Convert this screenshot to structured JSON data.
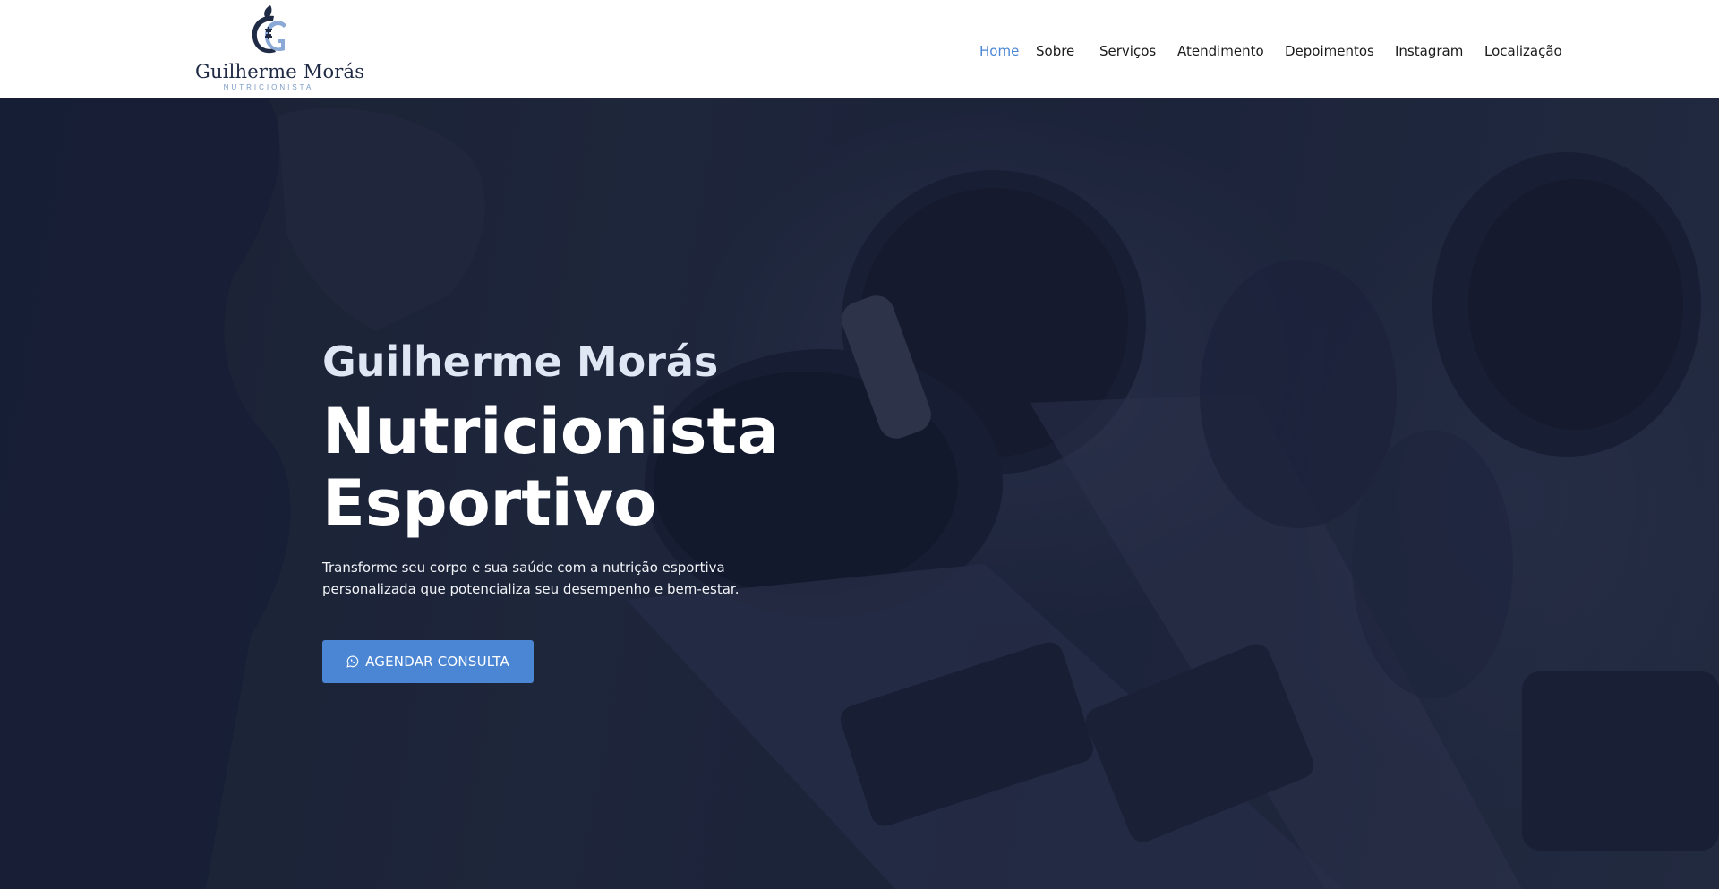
{
  "brand": {
    "name": "Guilherme Morás",
    "subtitle": "NUTRICIONISTA",
    "logo_icon": "apple-dumbbell-monogram-icon"
  },
  "nav": {
    "items": [
      {
        "label": "Home",
        "active": true
      },
      {
        "label": "Sobre"
      },
      {
        "label": "Serviços"
      },
      {
        "label": "Atendimento"
      },
      {
        "label": "Depoimentos"
      },
      {
        "label": "Instagram"
      },
      {
        "label": "Localização"
      }
    ]
  },
  "hero": {
    "name": "Guilherme Morás",
    "title_line1": "Nutricionista",
    "title_line2": "Esportivo",
    "description": "Transforme seu corpo e sua saúde com a nutrição esportiva personalizada que potencializa seu desempenho e bem-estar.",
    "cta_label": "AGENDAR CONSULTA",
    "cta_icon": "whatsapp-icon",
    "background": "gym-dumbbells-photo"
  },
  "colors": {
    "accent": "#4a86d4",
    "header_bg": "#ffffff",
    "hero_overlay": "#1b2236",
    "text_dark": "#1a1a1a"
  }
}
